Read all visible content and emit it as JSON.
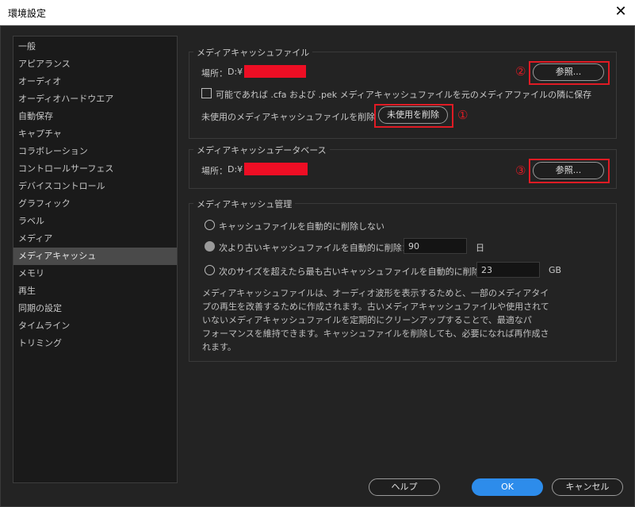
{
  "window": {
    "title": "環境設定"
  },
  "sidebar": {
    "items": [
      {
        "label": "一般"
      },
      {
        "label": "アピアランス"
      },
      {
        "label": "オーディオ"
      },
      {
        "label": "オーディオハードウエア"
      },
      {
        "label": "自動保存"
      },
      {
        "label": "キャプチャ"
      },
      {
        "label": "コラボレーション"
      },
      {
        "label": "コントロールサーフェス"
      },
      {
        "label": "デバイスコントロール"
      },
      {
        "label": "グラフィック"
      },
      {
        "label": "ラベル"
      },
      {
        "label": "メディア"
      },
      {
        "label": "メディアキャッシュ"
      },
      {
        "label": "メモリ"
      },
      {
        "label": "再生"
      },
      {
        "label": "同期の設定"
      },
      {
        "label": "タイムライン"
      },
      {
        "label": "トリミング"
      }
    ],
    "selected": "メディアキャッシュ"
  },
  "cache_files": {
    "title": "メディアキャッシュファイル",
    "location_label": "場所：",
    "location_value": "D:¥",
    "browse_label": "参照...",
    "browse_marker": "②",
    "checkbox_label": "可能であれば .cfa および .pek メディアキャッシュファイルを元のメディアファイルの隣に保存",
    "checkbox_checked": false,
    "delete_unused_label": "未使用のメディアキャッシュファイルを削除",
    "delete_unused_button": "未使用を削除",
    "delete_unused_marker": "①"
  },
  "cache_db": {
    "title": "メディアキャッシュデータベース",
    "location_label": "場所：",
    "location_value": "D:¥",
    "browse_label": "参照...",
    "browse_marker": "③"
  },
  "cache_management": {
    "title": "メディアキャッシュ管理",
    "options": [
      {
        "label": "キャッシュファイルを自動的に削除しない",
        "selected": false
      },
      {
        "label": "次より古いキャッシュファイルを自動的に削除：",
        "value": "90",
        "unit": "日",
        "selected": true
      },
      {
        "label": "次のサイズを超えたら最も古いキャッシュファイルを自動的に削除：",
        "value": "23",
        "unit": "GB",
        "selected": false
      }
    ],
    "description": [
      "メディアキャッシュファイルは、オーディオ波形を表示するためと、一部のメディアタイ",
      "プの再生を改善するために作成されます。古いメディアキャッシュファイルや使用されて",
      "いないメディアキャッシュファイルを定期的にクリーンアップすることで、最適なパ",
      "フォーマンスを維持できます。キャッシュファイルを削除しても、必要になれば再作成さ",
      "れます。"
    ]
  },
  "footer": {
    "help": "ヘルプ",
    "ok": "OK",
    "cancel": "キャンセル"
  },
  "colors": {
    "accent": "#2d8ceb",
    "highlight": "#e01b24",
    "redaction": "#ee0e24"
  }
}
